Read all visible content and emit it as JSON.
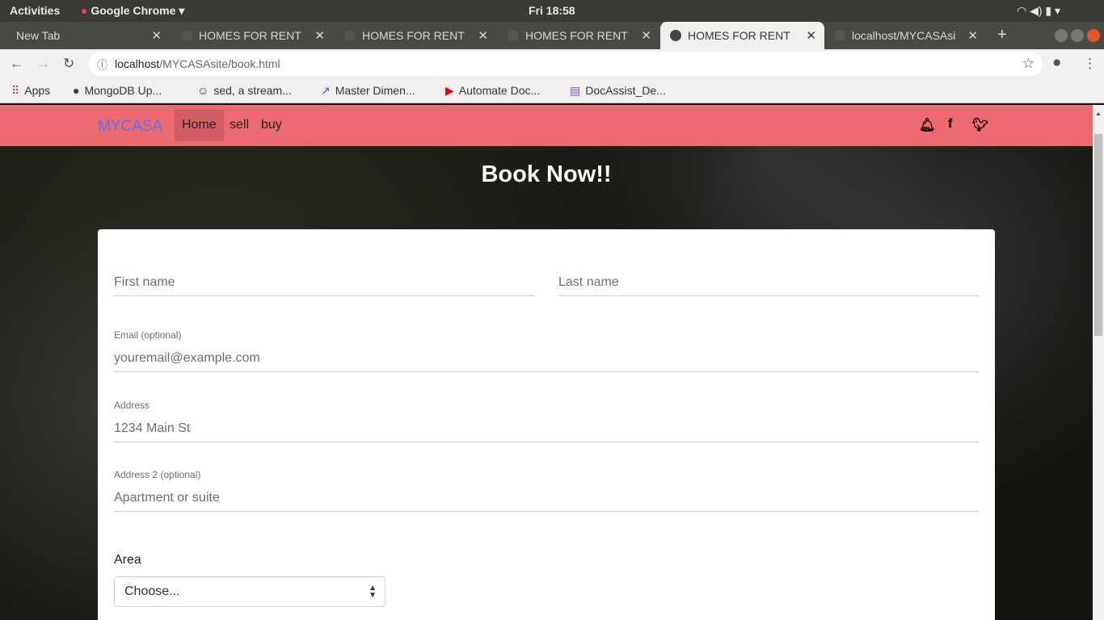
{
  "os": {
    "activities": "Activities",
    "app": "Google Chrome",
    "clock": "Fri 18:58"
  },
  "tabs": [
    {
      "title": "New Tab"
    },
    {
      "title": "HOMES FOR RENT"
    },
    {
      "title": "HOMES FOR RENT"
    },
    {
      "title": "HOMES FOR RENT"
    },
    {
      "title": "HOMES FOR RENT",
      "active": true
    },
    {
      "title": "localhost/MYCASAsi"
    }
  ],
  "address": {
    "host": "localhost",
    "path": "/MYCASAsite/book.html"
  },
  "bookmarks": [
    "Apps",
    "MongoDB Up...",
    "sed, a stream...",
    "Master Dimen...",
    "Automate Doc...",
    "DocAssist_De..."
  ],
  "nav": {
    "brand": "MYCASA",
    "links": [
      "Home",
      "sell",
      "buy"
    ]
  },
  "page": {
    "title": "Book Now!!"
  },
  "form": {
    "first_name": {
      "placeholder": "First name"
    },
    "last_name": {
      "placeholder": "Last name"
    },
    "email": {
      "label": "Email (optional)",
      "placeholder": "youremail@example.com"
    },
    "address": {
      "label": "Address",
      "placeholder": "1234 Main St"
    },
    "address2": {
      "label": "Address 2 (optional)",
      "placeholder": "Apartment or suite"
    },
    "area": {
      "label": "Area",
      "selected": "Choose..."
    }
  }
}
